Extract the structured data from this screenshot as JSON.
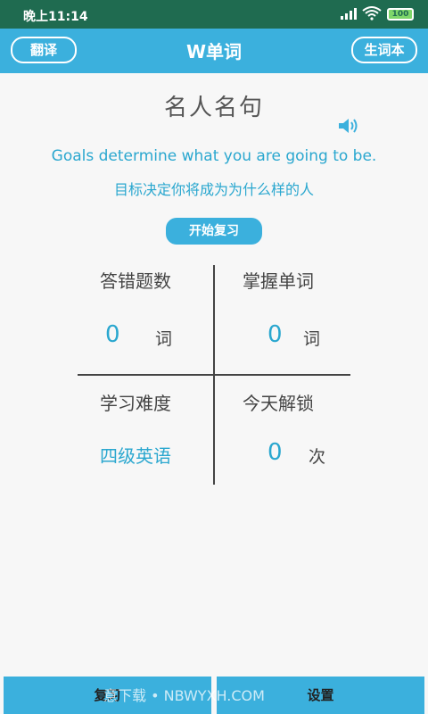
{
  "status": {
    "time": "晚上11:14",
    "battery": "100"
  },
  "appbar": {
    "title": "W单词",
    "left_button": "翻译",
    "right_button": "生词本"
  },
  "main": {
    "heading": "名人名句",
    "quote_en": "Goals determine what you are going to be.",
    "quote_zh": "目标决定你将成为为什么样的人",
    "review_button": "开始复习"
  },
  "stats": {
    "wrong": {
      "label": "答错题数",
      "value": "0",
      "unit": "词"
    },
    "mastered": {
      "label": "掌握单词",
      "value": "0",
      "unit": "词"
    },
    "difficulty": {
      "label": "学习难度",
      "value": "四级英语"
    },
    "unlock": {
      "label": "今天解锁",
      "value": "0",
      "unit": "次"
    }
  },
  "bottom": {
    "left": "复习",
    "right": "设置",
    "watermark": "意下载 • NBWYXH.COM"
  }
}
